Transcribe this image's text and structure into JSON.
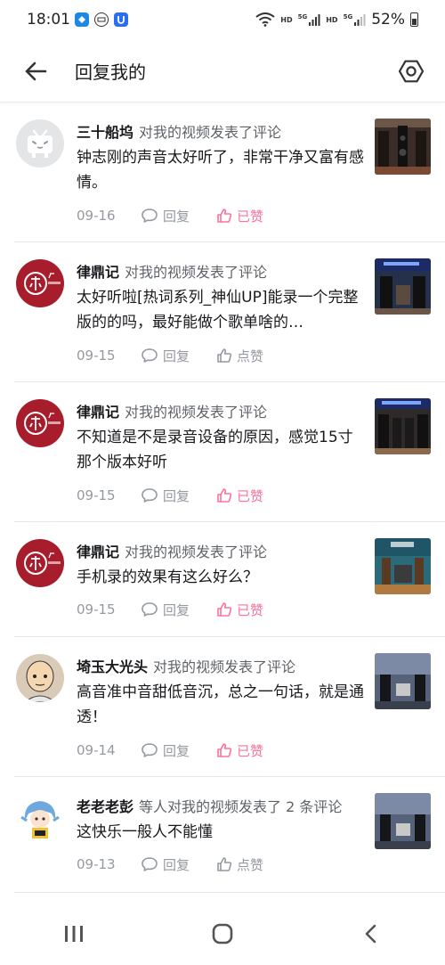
{
  "status_bar": {
    "time": "18:01",
    "network_labels": [
      "HD",
      "5G",
      "HD",
      "5G"
    ],
    "battery": "52%"
  },
  "header": {
    "title": "回复我的",
    "back_icon": "back-arrow-icon",
    "settings_icon": "hexagon-settings-icon"
  },
  "colors": {
    "liked": "#fb7299",
    "muted": "#9499a0",
    "text": "#18191c"
  },
  "replies": [
    {
      "user": "三十船坞",
      "action": "对我的视频发表了评论",
      "comment": "钟志刚的声音太好听了，非常干净又富有感情。",
      "date": "09-16",
      "reply_label": "回复",
      "like_label": "已赞",
      "liked": true
    },
    {
      "user": "律鼎记",
      "action": "对我的视频发表了评论",
      "comment": "太好听啦[热词系列_神仙UP]能录一个完整版的的吗，最好能做个歌单啥的…",
      "date": "09-15",
      "reply_label": "回复",
      "like_label": "点赞",
      "liked": false
    },
    {
      "user": "律鼎记",
      "action": "对我的视频发表了评论",
      "comment": "不知道是不是录音设备的原因，感觉15寸那个版本好听",
      "date": "09-15",
      "reply_label": "回复",
      "like_label": "已赞",
      "liked": true
    },
    {
      "user": "律鼎记",
      "action": "对我的视频发表了评论",
      "comment": "手机录的效果有这么好么？",
      "date": "09-15",
      "reply_label": "回复",
      "like_label": "已赞",
      "liked": true
    },
    {
      "user": "埼玉大光头",
      "action": "对我的视频发表了评论",
      "comment": "高音准中音甜低音沉，总之一句话，就是通透！",
      "date": "09-14",
      "reply_label": "回复",
      "like_label": "已赞",
      "liked": true
    },
    {
      "user": "老老老彭",
      "action": "等人对我的视频发表了 2 条评论",
      "comment": "这快乐一般人不能懂",
      "date": "09-13",
      "reply_label": "回复",
      "like_label": "点赞",
      "liked": false
    }
  ]
}
